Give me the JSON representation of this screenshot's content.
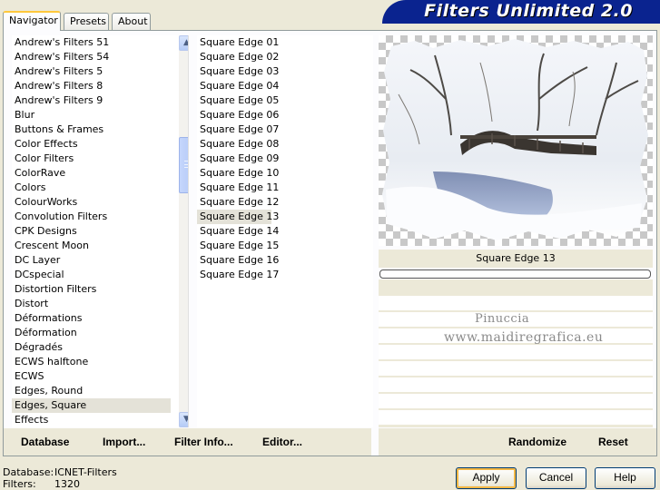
{
  "tabs": [
    {
      "label": "Navigator",
      "active": true
    },
    {
      "label": "Presets",
      "active": false
    },
    {
      "label": "About",
      "active": false
    }
  ],
  "app_title": "Filters Unlimited 2.0",
  "categories": {
    "items": [
      "Andrew's Filters 51",
      "Andrew's Filters 54",
      "Andrew's Filters 5",
      "Andrew's Filters 8",
      "Andrew's Filters 9",
      "Blur",
      "Buttons & Frames",
      "Color Effects",
      "Color Filters",
      "ColorRave",
      "Colors",
      "ColourWorks",
      "Convolution Filters",
      "CPK Designs",
      "Crescent Moon",
      "DC Layer",
      "DCspecial",
      "Distortion Filters",
      "Distort",
      "Déformations",
      "Déformation",
      "Dégradés",
      "ECWS halftone",
      "ECWS",
      "Edges, Round",
      "Edges, Square",
      "Effects"
    ],
    "selected": "Edges, Square"
  },
  "filters": {
    "items": [
      "Square Edge 01",
      "Square Edge 02",
      "Square Edge 03",
      "Square Edge 04",
      "Square Edge 05",
      "Square Edge 06",
      "Square Edge 07",
      "Square Edge 08",
      "Square Edge 09",
      "Square Edge 10",
      "Square Edge 11",
      "Square Edge 12",
      "Square Edge 13",
      "Square Edge 14",
      "Square Edge 15",
      "Square Edge 16",
      "Square Edge 17"
    ],
    "selected": "Square Edge 13"
  },
  "preview": {
    "filter_name": "Square Edge 13",
    "progress": 0,
    "watermark_line1": "Pinuccia",
    "watermark_line2": "www.maidiregrafica.eu"
  },
  "bottom_buttons": {
    "database": "Database",
    "import": "Import...",
    "filter_info": "Filter Info...",
    "editor": "Editor...",
    "randomize": "Randomize",
    "reset": "Reset"
  },
  "status": {
    "database_label": "Database:",
    "database_value": "ICNET-Filters",
    "filters_label": "Filters:",
    "filters_value": "1320"
  },
  "dialog_buttons": {
    "apply": "Apply",
    "cancel": "Cancel",
    "help": "Help"
  },
  "colors": {
    "title_banner": "#0a238f",
    "selection": "#e4e2d8",
    "default_button_ring": "#f4b845"
  }
}
